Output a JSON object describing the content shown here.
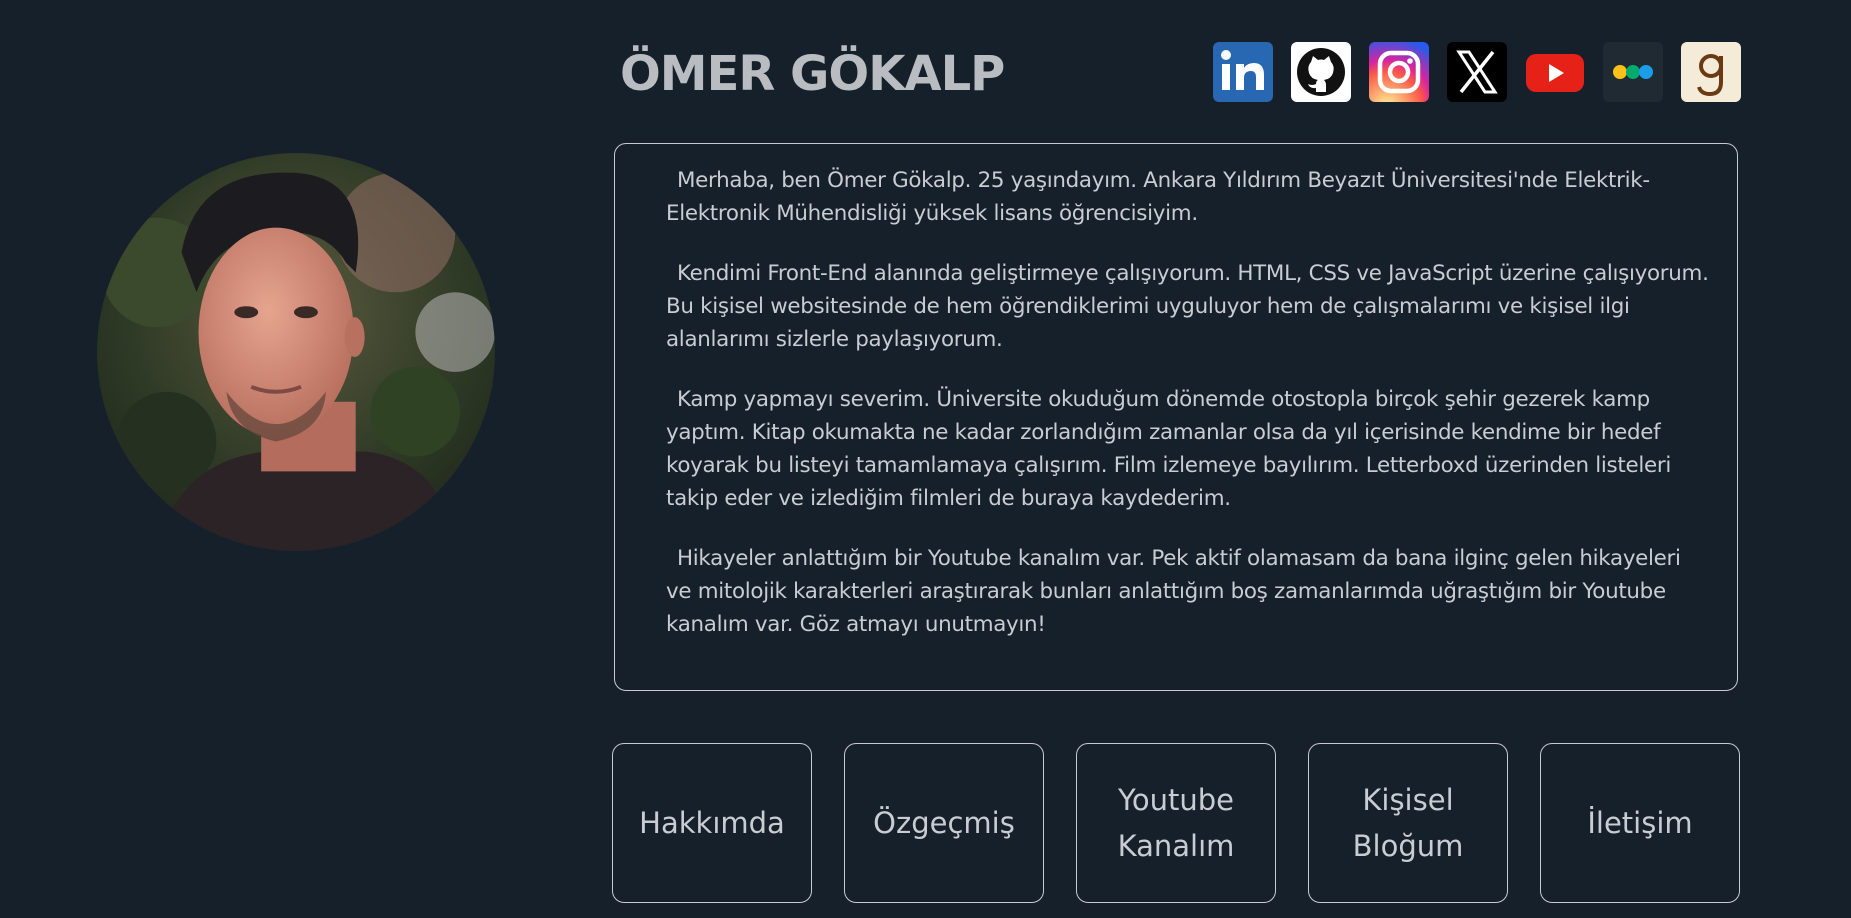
{
  "profile": {
    "name": "ÖMER GÖKALP",
    "photo_alt": "Ömer Gökalp"
  },
  "socials": [
    {
      "name": "linkedin",
      "icon": "linkedin-icon",
      "color": "#2867b2"
    },
    {
      "name": "github",
      "icon": "github-icon",
      "color": "#ffffff"
    },
    {
      "name": "instagram",
      "icon": "instagram-icon",
      "color": "#d6249f"
    },
    {
      "name": "x",
      "icon": "x-icon",
      "color": "#000000"
    },
    {
      "name": "youtube",
      "icon": "youtube-icon",
      "color": "#e62117"
    },
    {
      "name": "medium",
      "icon": "medium-icon",
      "color": "#202a33"
    },
    {
      "name": "goodreads",
      "icon": "goodreads-icon",
      "color": "#f4ecd8"
    }
  ],
  "about": {
    "paragraphs": [
      "Merhaba, ben Ömer Gökalp. 25 yaşındayım. Ankara Yıldırım Beyazıt Üniversitesi'nde Elektrik-Elektronik Mühendisliği yüksek lisans öğrencisiyim.",
      "Kendimi Front-End alanında geliştirmeye çalışıyorum. HTML, CSS ve JavaScript üzerine çalışıyorum. Bu kişisel websitesinde de hem öğrendiklerimi uyguluyor hem de çalışmalarımı ve kişisel ilgi alanlarımı sizlerle paylaşıyorum.",
      "Kamp yapmayı severim. Üniversite okuduğum dönemde otostopla birçok şehir gezerek kamp yaptım. Kitap okumakta ne kadar zorlandığım zamanlar olsa da yıl içerisinde kendime bir hedef koyarak bu listeyi tamamlamaya çalışırım. Film izlemeye bayılırım. Letterboxd üzerinden listeleri takip eder ve izlediğim filmleri de buraya kaydederim.",
      "Hikayeler anlattığım bir Youtube kanalım var. Pek aktif olamasam da bana ilginç gelen hikayeleri ve mitolojik karakterleri araştırarak bunları anlattığım boş zamanlarımda uğraştığım bir Youtube kanalım var. Göz atmayı unutmayın!"
    ]
  },
  "nav": [
    {
      "label": "Hakkımda"
    },
    {
      "label": "Özgeçmiş"
    },
    {
      "label": "Youtube Kanalım"
    },
    {
      "label": "Kişisel Bloğum"
    },
    {
      "label": "İletişim"
    }
  ],
  "theme": {
    "background": "#16202b",
    "text": "#c9ccd1",
    "border": "#c7cad0"
  }
}
